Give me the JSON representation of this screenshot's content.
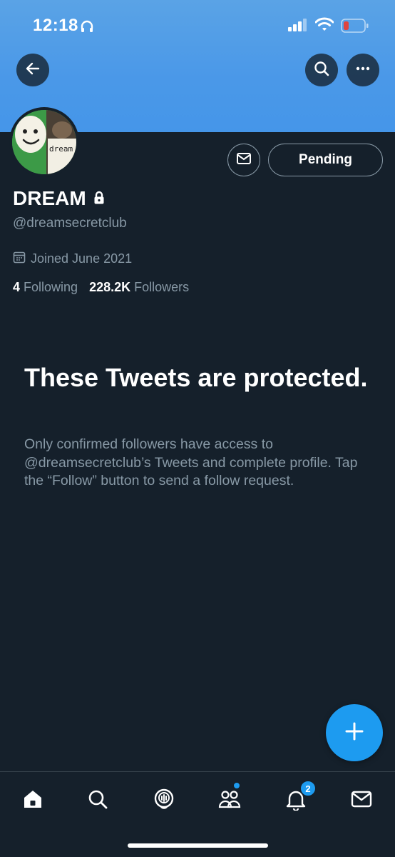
{
  "status_bar": {
    "time": "12:18",
    "icons": [
      "headphones-icon",
      "signal-icon",
      "wifi-icon",
      "battery-low-icon"
    ],
    "battery_color": "#e0443e"
  },
  "header": {
    "banner_color": "#4a98e8",
    "back_icon": "arrow-left-icon",
    "search_icon": "search-icon",
    "more_icon": "more-dots-icon"
  },
  "profile": {
    "display_name": "DREAM",
    "handle": "@dreamsecretclub",
    "joined": "Joined June 2021",
    "following_count": "4",
    "following_label": "Following",
    "followers_count": "228.2K",
    "followers_label": "Followers",
    "avatar_text": "dream",
    "pending_label": "Pending",
    "locked": true
  },
  "protected_notice": {
    "title": "These Tweets are protected.",
    "body": "Only confirmed followers have access to @dreamsecretclub’s Tweets and complete profile. Tap the “Follow” button to send a follow request."
  },
  "fab": {
    "icon": "plus-icon"
  },
  "tab_bar": {
    "items": [
      "home-icon",
      "search-icon",
      "spaces-icon",
      "communities-icon",
      "notifications-icon",
      "messages-icon"
    ],
    "notifications_badge": "2",
    "accent_color": "#1d9bf0"
  }
}
